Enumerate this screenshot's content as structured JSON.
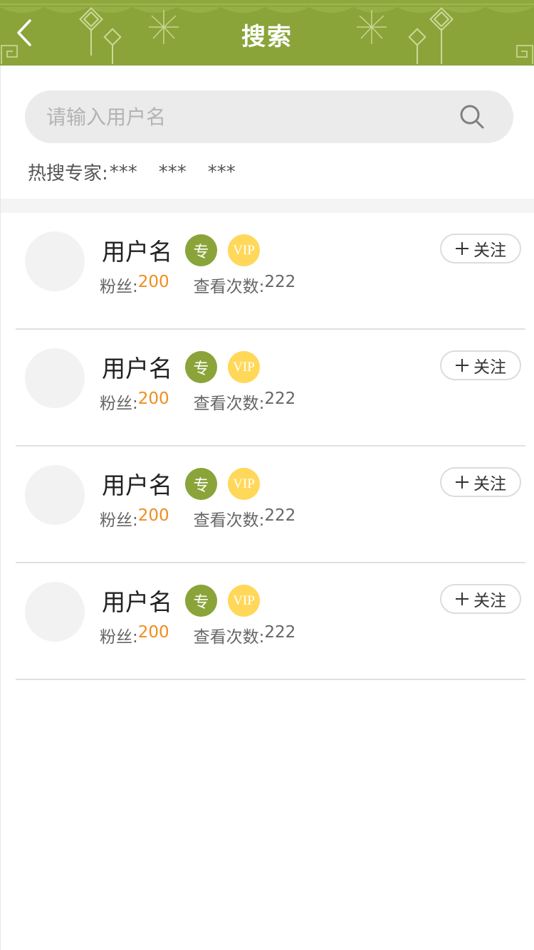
{
  "header": {
    "title": "搜索",
    "back_icon": "chevron-left-icon",
    "theme_color": "#8aa43a"
  },
  "search": {
    "placeholder": "请输入用户名",
    "value": "",
    "icon": "search-icon"
  },
  "hot": {
    "label": "热搜专家:",
    "items": [
      "***",
      "***",
      "***"
    ]
  },
  "users": [
    {
      "name": "用户名",
      "badge_expert": "专",
      "badge_vip": "VIP",
      "fans_label": "粉丝:",
      "fans": "200",
      "views_label": "查看次数:",
      "views": "222",
      "follow_label": "关注"
    },
    {
      "name": "用户名",
      "badge_expert": "专",
      "badge_vip": "VIP",
      "fans_label": "粉丝:",
      "fans": "200",
      "views_label": "查看次数:",
      "views": "222",
      "follow_label": "关注"
    },
    {
      "name": "用户名",
      "badge_expert": "专",
      "badge_vip": "VIP",
      "fans_label": "粉丝:",
      "fans": "200",
      "views_label": "查看次数:",
      "views": "222",
      "follow_label": "关注"
    },
    {
      "name": "用户名",
      "badge_expert": "专",
      "badge_vip": "VIP",
      "fans_label": "粉丝:",
      "fans": "200",
      "views_label": "查看次数:",
      "views": "222",
      "follow_label": "关注"
    }
  ],
  "colors": {
    "accent_green": "#8aa43a",
    "vip_yellow": "#ffd85a",
    "fans_orange": "#f08d1e"
  }
}
